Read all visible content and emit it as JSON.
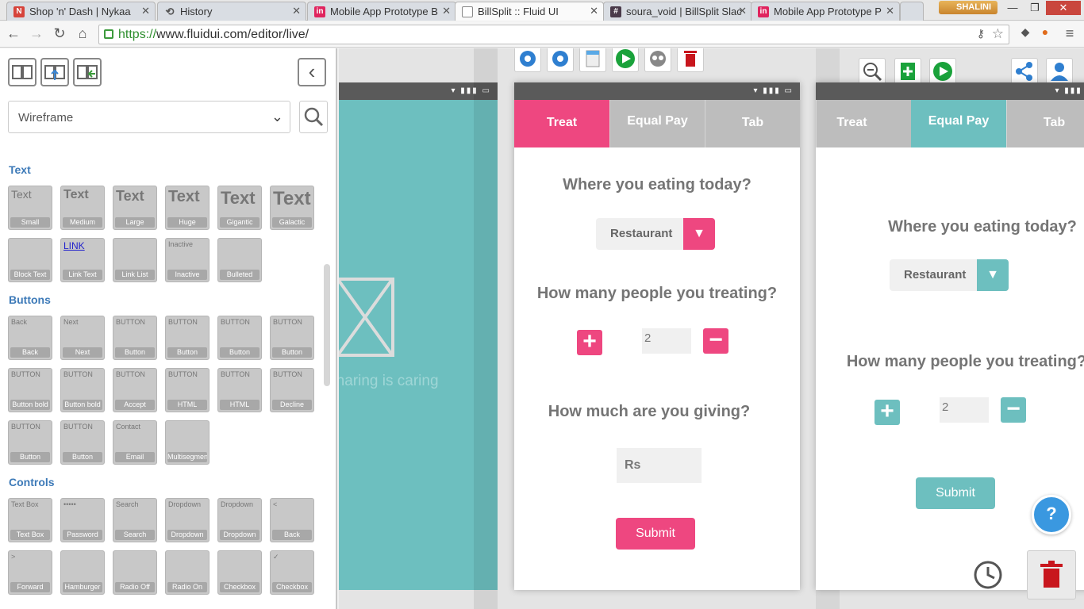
{
  "browser": {
    "tabs": [
      {
        "title": "Shop 'n' Dash | Nykaa",
        "favicon": "N"
      },
      {
        "title": "History",
        "favicon": "history-icon"
      },
      {
        "title": "Mobile App Prototype B",
        "favicon": "in"
      },
      {
        "title": "BillSplit :: Fluid UI",
        "favicon": "page-icon"
      },
      {
        "title": "soura_void | BillSplit Slac",
        "favicon": "#"
      },
      {
        "title": "Mobile App Prototype P",
        "favicon": "in"
      }
    ],
    "user": "SHALINI",
    "url_scheme": "https://",
    "url_rest": "www.fluidui.com/editor/live/"
  },
  "sidebar": {
    "library": "Wireframe",
    "sections": {
      "text": "Text",
      "buttons": "Buttons",
      "controls": "Controls"
    },
    "text_widgets": [
      "Small",
      "Medium",
      "Large",
      "Huge",
      "Gigantic",
      "Galactic",
      "Block Text",
      "Link Text",
      "Link List",
      "Inactive",
      "Bulleted"
    ],
    "text_previews": [
      "Text",
      "Text",
      "Text",
      "Text",
      "Text",
      "Text",
      "",
      "LINK",
      "",
      "Inactive",
      ""
    ],
    "button_widgets": [
      "Back",
      "Next",
      "Button",
      "Button",
      "Button",
      "Button",
      "Button bold",
      "Button bold",
      "Accept",
      "HTML",
      "HTML",
      "Decline",
      "Button",
      "Button",
      "Email",
      "Multisegmen"
    ],
    "button_previews": [
      "Back",
      "Next",
      "BUTTON",
      "BUTTON",
      "BUTTON",
      "BUTTON",
      "BUTTON",
      "BUTTON",
      "BUTTON",
      "BUTTON",
      "BUTTON",
      "BUTTON",
      "BUTTON",
      "BUTTON",
      "Contact",
      ""
    ],
    "control_widgets": [
      "Text Box",
      "Password",
      "Search",
      "Dropdown",
      "Dropdown",
      "Back",
      "Forward",
      "Hamburger",
      "Radio Off",
      "Radio On",
      "Checkbox",
      "Checkbox"
    ],
    "control_previews": [
      "Text Box",
      "•••••",
      "Search",
      "Dropdown",
      "Dropdown",
      "<",
      ">",
      "",
      "",
      "",
      "",
      "✓"
    ]
  },
  "screen_left": {
    "caption": "Sharing is caring"
  },
  "screen_main": {
    "tabs": [
      "Treat",
      "Equal Pay",
      "Tab"
    ],
    "q1": "Where you eating today?",
    "dropdown": "Restaurant",
    "q2": "How many people you treating?",
    "count": "2",
    "q3": "How much are you giving?",
    "currency_placeholder": "Rs",
    "submit": "Submit"
  },
  "screen_right": {
    "tabs": [
      "Treat",
      "Equal Pay",
      "Tab"
    ],
    "q1": "Where you eating today?",
    "dropdown": "Restaurant",
    "q2": "How many people you treating?",
    "count": "2",
    "submit": "Submit"
  },
  "help": "?",
  "colors": {
    "pink": "#ee4780",
    "teal": "#6dbfbf",
    "blue": "#3d7ab8"
  }
}
